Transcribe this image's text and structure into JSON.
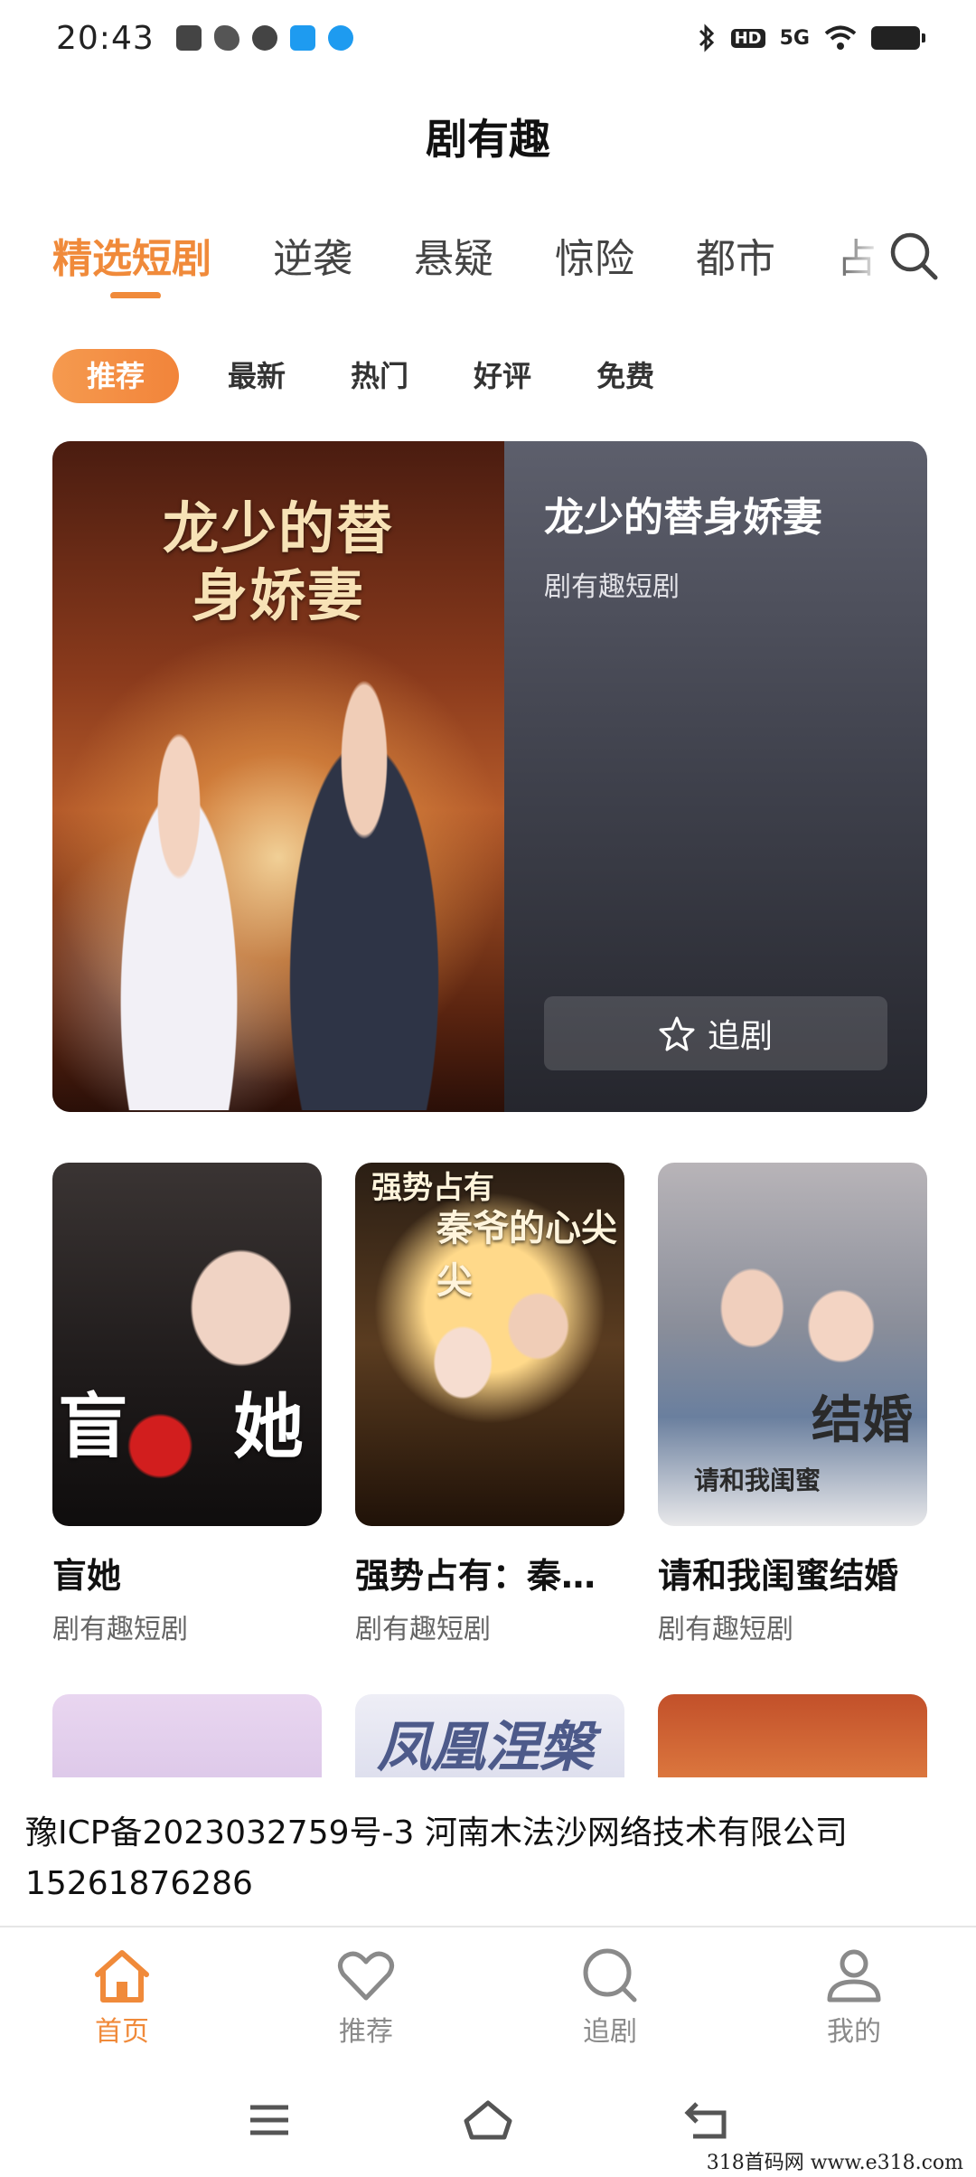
{
  "status_bar": {
    "time": "20:43",
    "left_icons": [
      "clipboard-icon",
      "wechat-icon",
      "check-circle-icon",
      "qq-icon",
      "baidu-paw-icon"
    ],
    "right_icons": [
      "bluetooth-icon",
      "hd-icon",
      "signal-5g-icon",
      "wifi-icon",
      "battery-icon"
    ],
    "hd_text": "HD",
    "network_text": "5G"
  },
  "header": {
    "title": "剧有趣"
  },
  "category_tabs": [
    {
      "label": "精选短剧",
      "active": true
    },
    {
      "label": "逆袭",
      "active": false
    },
    {
      "label": "悬疑",
      "active": false
    },
    {
      "label": "惊险",
      "active": false
    },
    {
      "label": "都市",
      "active": false
    },
    {
      "label": "占",
      "active": false
    }
  ],
  "filter_chips": [
    {
      "label": "推荐",
      "active": true
    },
    {
      "label": "最新",
      "active": false
    },
    {
      "label": "热门",
      "active": false
    },
    {
      "label": "好评",
      "active": false
    },
    {
      "label": "免费",
      "active": false
    }
  ],
  "featured": {
    "poster_title": "龙少的替身娇妻",
    "title": "龙少的替身娇妻",
    "subtitle": "剧有趣短剧",
    "follow_label": "追剧"
  },
  "grid": [
    {
      "title": "盲她",
      "subtitle": "剧有趣短剧",
      "poster_text_a": "盲",
      "poster_text_b": "她"
    },
    {
      "title": "强势占有：秦…",
      "subtitle": "剧有趣短剧",
      "poster_text_a": "强势占有",
      "poster_text_b": "秦爷的心尖尖"
    },
    {
      "title": "请和我闺蜜结婚",
      "subtitle": "剧有趣短剧",
      "poster_text_a": "结婚",
      "poster_text_b": "请和我闺蜜"
    }
  ],
  "grid_row2": {
    "poster_b_text": "凤凰涅槃"
  },
  "icp_footer": {
    "text": "豫ICP备2023032759号-3  河南木法沙网络技术有限公司  15261876286"
  },
  "bottom_nav": [
    {
      "label": "首页",
      "icon": "home-icon",
      "active": true
    },
    {
      "label": "推荐",
      "icon": "heart-icon",
      "active": false
    },
    {
      "label": "追剧",
      "icon": "search-icon",
      "active": false
    },
    {
      "label": "我的",
      "icon": "user-icon",
      "active": false
    }
  ],
  "system_nav": [
    "menu-icon",
    "home-outline-icon",
    "back-icon"
  ],
  "watermark": "318首码网  www.e318.com",
  "colors": {
    "accent": "#f08a3a",
    "card_dark": "#3f414c",
    "inactive": "#8a8a8a"
  }
}
